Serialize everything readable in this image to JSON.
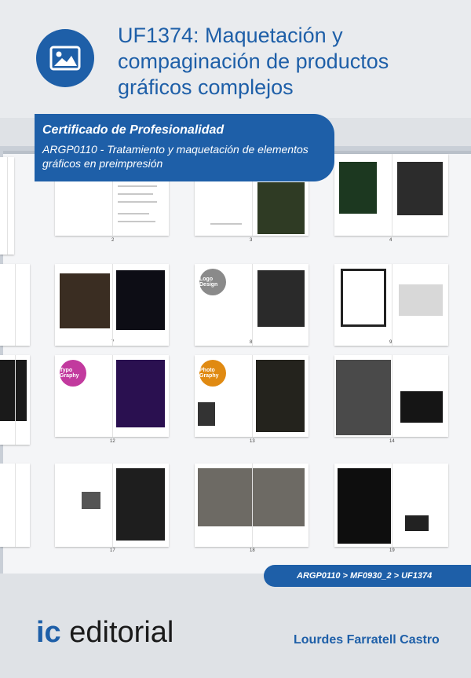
{
  "title": "UF1374: Maquetación y compaginación de productos gráficos complejos",
  "certificate": {
    "heading": "Certificado de Profesionalidad",
    "subtitle": "ARGP0110 - Tratamiento y maquetación de elementos gráficos en preimpresión"
  },
  "breadcrumb": "ARGP0110 > MF0930_2 > UF1374",
  "publisher": {
    "prefix": "ic",
    "name": " editorial"
  },
  "author": "Lourdes Farratell Castro",
  "page_numbers": [
    "2",
    "3",
    "4",
    "7",
    "8",
    "9",
    "12",
    "13",
    "14",
    "17",
    "18",
    "19"
  ],
  "thumb_badges": [
    "Logo Design",
    "Typo Graphy",
    "Photo Graphy"
  ],
  "colors": {
    "brand_blue": "#1e5fa8",
    "background": "#dfe2e6"
  },
  "icons": {
    "logo": "image-icon"
  }
}
